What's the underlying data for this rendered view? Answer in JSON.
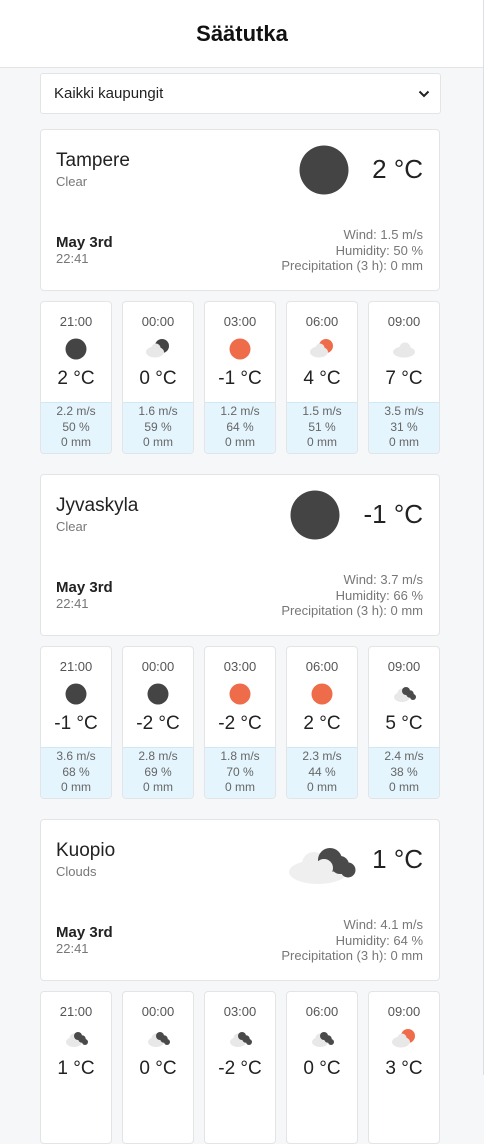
{
  "header": {
    "title": "Säätutka"
  },
  "city_select": {
    "value": "Kaikki kaupungit"
  },
  "cities": [
    {
      "name": "Tampere",
      "desc": "Clear",
      "icon": "clear-night-icon",
      "temp": "2 °C",
      "date": "May 3rd",
      "time": "22:41",
      "wind": "Wind: 1.5 m/s",
      "humidity": "Humidity: 50 %",
      "precip": "Precipitation (3 h): 0 mm",
      "forecast": [
        {
          "hour": "21:00",
          "icon": "clear-night-icon",
          "temp": "2 °C",
          "wind": "2.2 m/s",
          "humidity": "50 %",
          "precip": "0 mm"
        },
        {
          "hour": "00:00",
          "icon": "night-partly-cloudy-icon",
          "temp": "0 °C",
          "wind": "1.6 m/s",
          "humidity": "59 %",
          "precip": "0 mm"
        },
        {
          "hour": "03:00",
          "icon": "sun-icon",
          "temp": "-1 °C",
          "wind": "1.2 m/s",
          "humidity": "64 %",
          "precip": "0 mm"
        },
        {
          "hour": "06:00",
          "icon": "day-partly-cloudy-icon",
          "temp": "4 °C",
          "wind": "1.5 m/s",
          "humidity": "51 %",
          "precip": "0 mm"
        },
        {
          "hour": "09:00",
          "icon": "cloud-icon",
          "temp": "7 °C",
          "wind": "3.5 m/s",
          "humidity": "31 %",
          "precip": "0 mm"
        }
      ]
    },
    {
      "name": "Jyvaskyla",
      "desc": "Clear",
      "icon": "clear-night-icon",
      "temp": "-1 °C",
      "date": "May 3rd",
      "time": "22:41",
      "wind": "Wind: 3.7 m/s",
      "humidity": "Humidity: 66 %",
      "precip": "Precipitation (3 h): 0 mm",
      "forecast": [
        {
          "hour": "21:00",
          "icon": "clear-night-icon",
          "temp": "-1 °C",
          "wind": "3.6 m/s",
          "humidity": "68 %",
          "precip": "0 mm"
        },
        {
          "hour": "00:00",
          "icon": "clear-night-icon",
          "temp": "-2 °C",
          "wind": "2.8 m/s",
          "humidity": "69 %",
          "precip": "0 mm"
        },
        {
          "hour": "03:00",
          "icon": "sun-icon",
          "temp": "-2 °C",
          "wind": "1.8 m/s",
          "humidity": "70 %",
          "precip": "0 mm"
        },
        {
          "hour": "06:00",
          "icon": "sun-icon",
          "temp": "2 °C",
          "wind": "2.3 m/s",
          "humidity": "44 %",
          "precip": "0 mm"
        },
        {
          "hour": "09:00",
          "icon": "dark-clouds-icon",
          "temp": "5 °C",
          "wind": "2.4 m/s",
          "humidity": "38 %",
          "precip": "0 mm"
        }
      ]
    },
    {
      "name": "Kuopio",
      "desc": "Clouds",
      "icon": "clouds-icon",
      "temp": "1 °C",
      "date": "May 3rd",
      "time": "22:41",
      "wind": "Wind: 4.1 m/s",
      "humidity": "Humidity: 64 %",
      "precip": "Precipitation (3 h): 0 mm",
      "forecast": [
        {
          "hour": "21:00",
          "icon": "dark-clouds-icon",
          "temp": "1 °C",
          "wind": "",
          "humidity": "",
          "precip": ""
        },
        {
          "hour": "00:00",
          "icon": "dark-clouds-icon",
          "temp": "0 °C",
          "wind": "",
          "humidity": "",
          "precip": ""
        },
        {
          "hour": "03:00",
          "icon": "dark-clouds-icon",
          "temp": "-2 °C",
          "wind": "",
          "humidity": "",
          "precip": ""
        },
        {
          "hour": "06:00",
          "icon": "dark-clouds-icon",
          "temp": "0 °C",
          "wind": "",
          "humidity": "",
          "precip": ""
        },
        {
          "hour": "09:00",
          "icon": "day-partly-cloudy-icon",
          "temp": "3 °C",
          "wind": "",
          "humidity": "",
          "precip": ""
        }
      ]
    }
  ],
  "colors": {
    "sun": "#ef6c4a",
    "night": "#444444",
    "cloud_dark": "#4a4a4a",
    "cloud_light": "#e8e8e8",
    "forecast_bottom": "#e4f5fd"
  }
}
